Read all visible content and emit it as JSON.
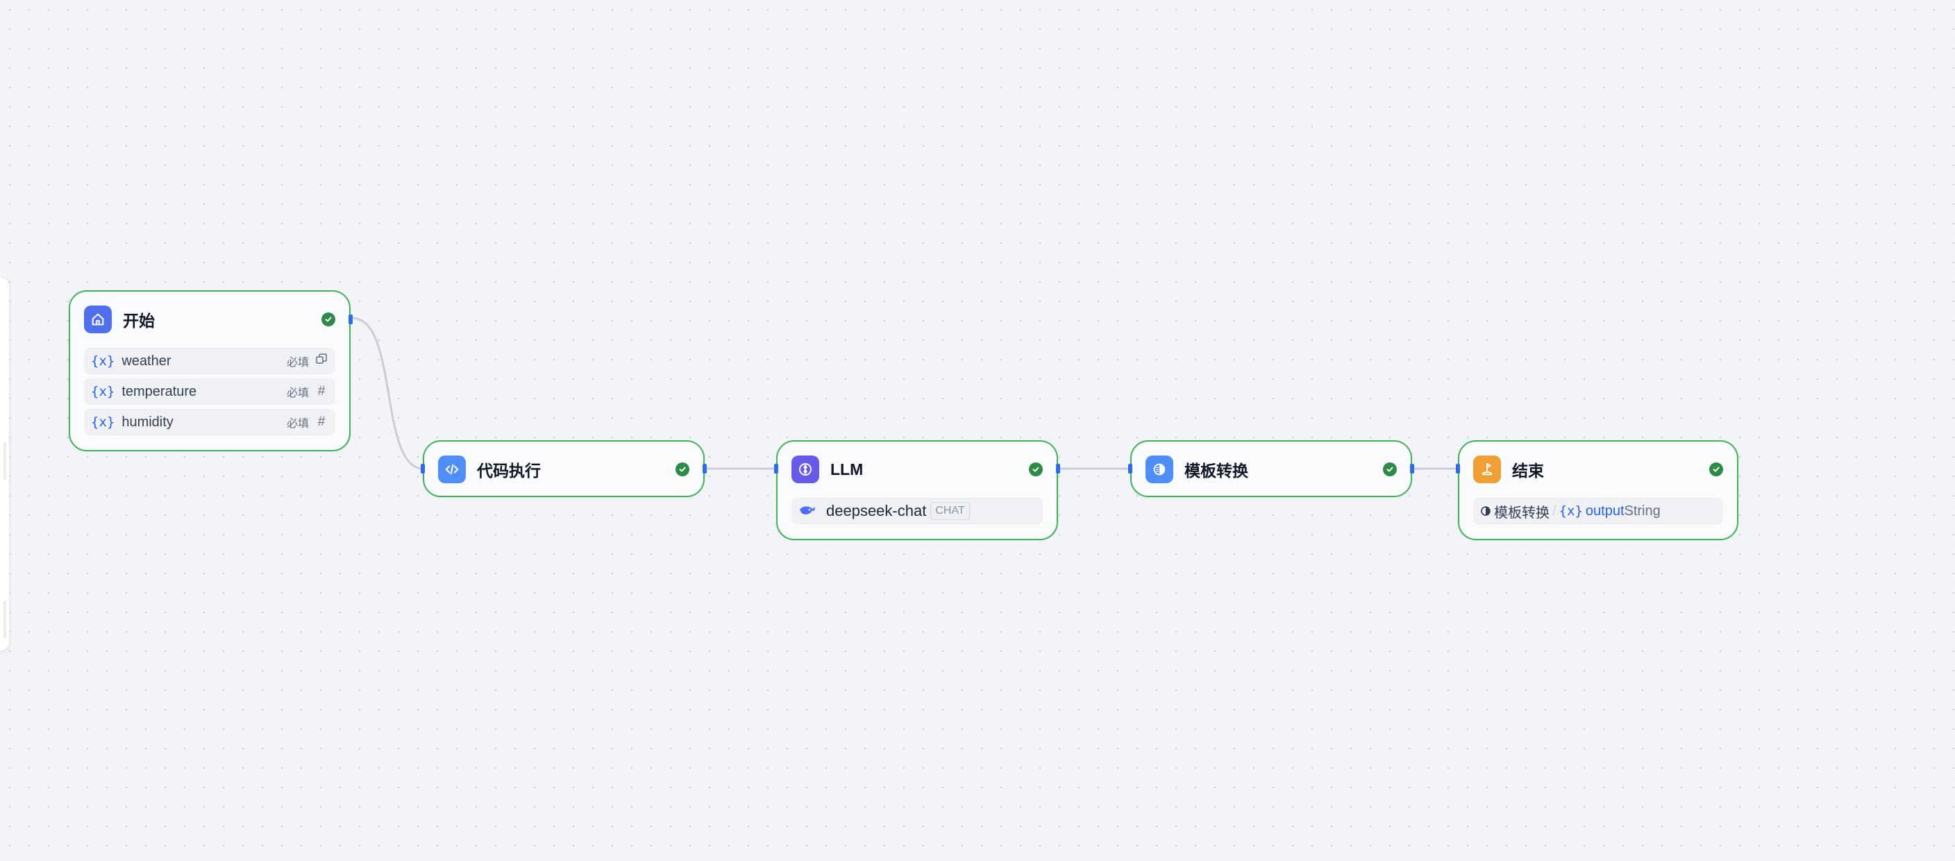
{
  "colors": {
    "canvas_bg": "#f2f4f7",
    "node_border_success": "#3fb35b",
    "edge": "#c8cdd6",
    "handle": "#2e6be6",
    "start_icon_bg": "#4f6fee",
    "code_icon_bg": "#4f8ef7",
    "llm_icon_bg": "#6a5ae8",
    "template_icon_bg": "#4f8ef7",
    "end_icon_bg": "#ef9f33",
    "status_ok": "#2e8b47"
  },
  "nodes": {
    "start": {
      "title": "开始",
      "status": "success",
      "icon": "home-icon",
      "variables": [
        {
          "marker": "{x}",
          "name": "weather",
          "required": "必填",
          "type_icon": "paragraph-icon"
        },
        {
          "marker": "{x}",
          "name": "temperature",
          "required": "必填",
          "type_icon": "number-icon",
          "type_glyph": "#"
        },
        {
          "marker": "{x}",
          "name": "humidity",
          "required": "必填",
          "type_icon": "number-icon",
          "type_glyph": "#"
        }
      ]
    },
    "code": {
      "title": "代码执行",
      "status": "success",
      "icon": "code-icon"
    },
    "llm": {
      "title": "LLM",
      "status": "success",
      "icon": "brain-icon",
      "model": {
        "name": "deepseek-chat",
        "badge": "CHAT",
        "icon": "deepseek-whale-icon"
      }
    },
    "template": {
      "title": "模板转换",
      "status": "success",
      "icon": "template-icon"
    },
    "end": {
      "title": "结束",
      "status": "success",
      "icon": "end-flag-icon",
      "output": {
        "source_node": "模板转换",
        "marker": "{x}",
        "var_name": "output",
        "type": "String",
        "source_icon": "template-icon"
      }
    }
  }
}
